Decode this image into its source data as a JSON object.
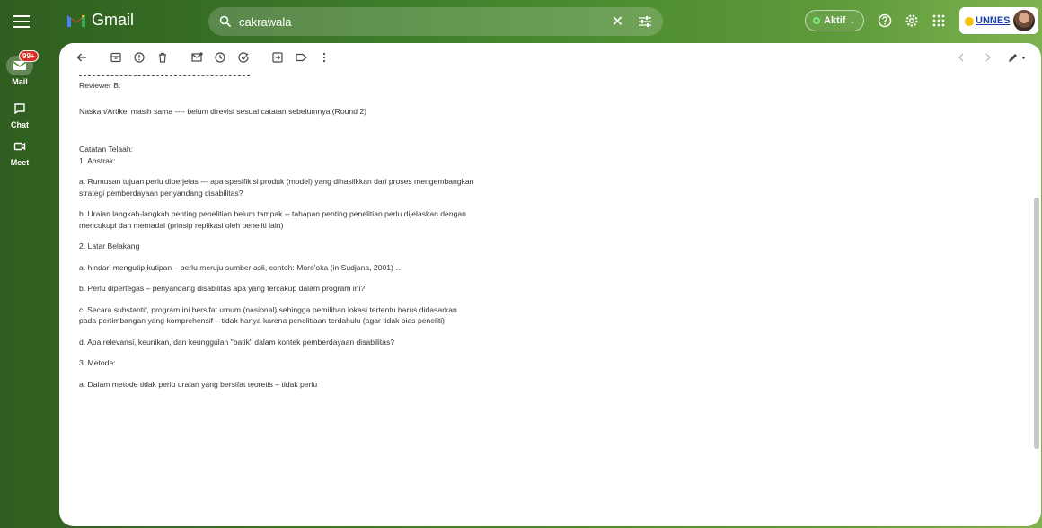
{
  "header": {
    "app_name": "Gmail",
    "search_query": "cakrawala",
    "status_label": "Aktif",
    "org_label": "UNNES"
  },
  "rail": {
    "mail_badge": "99+",
    "items": [
      {
        "label": "Mail"
      },
      {
        "label": "Chat"
      },
      {
        "label": "Meet"
      }
    ]
  },
  "email": {
    "reviewer": "Reviewer B:",
    "paragraphs": [
      "Naskah/Artikel masih sama ---- belum direvisi sesuai catatan sebelumnya (Round 2)",
      "Catatan Telaah:\n1. Abstrak:",
      "a. Rumusan tujuan perlu diperjelas --- apa spesifikisi produk (model) yang dihasilkkan dari proses mengembangkan strategi pemberdayaan penyandang disabilitas?",
      "b. Uraian langkah-langkah penting penelitian belum tampak --  tahapan penting penelitian perlu dijelaskan dengan mencukupi dan memadai (prinsip replikasi oleh peneliti lain)",
      "2. Latar Belakang",
      "a. hindari mengutip kutipan – perlu meruju sumber asli, contoh: Moro'oka (in Sudjana, 2001) …",
      "b. Perlu dipertegas – penyandang disabilitas apa yang tercakup dalam program ini?",
      "c. Secara substantif, program ini bersifat umum (nasional) sehingga pemilihan lokasi tertentu harus didasarkan pada pertimbangan yang komprehensif – tidak hanya karena penelitiaan terdahulu (agar tidak bias peneliti)",
      "d. Apa relevansi, keunikan, dan keunggulan \"batik\" dalam kontek pemberdayaan disabilitas?",
      "3. Metode:",
      "a. Dalam metode tidak perlu uraian yang bersifat teoretis – tidak perlu"
    ]
  }
}
